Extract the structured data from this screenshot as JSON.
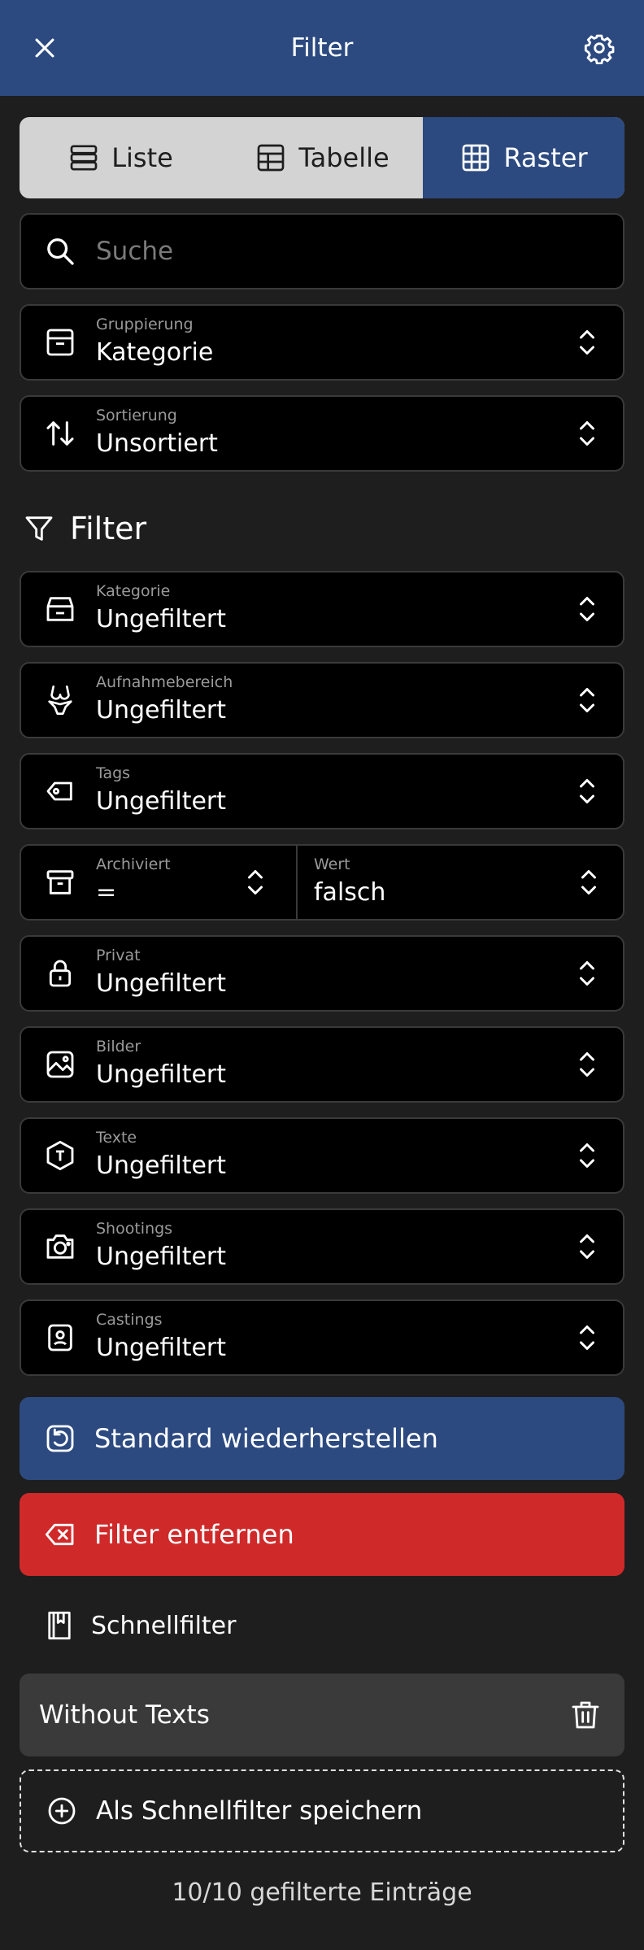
{
  "header": {
    "title": "Filter",
    "close_icon": "close-icon",
    "settings_icon": "gear-icon"
  },
  "view_toggle": {
    "items": [
      {
        "label": "Liste",
        "icon": "list-icon",
        "active": false
      },
      {
        "label": "Tabelle",
        "icon": "table-icon",
        "active": false
      },
      {
        "label": "Raster",
        "icon": "grid-icon",
        "active": true
      }
    ]
  },
  "search": {
    "placeholder": "Suche",
    "value": ""
  },
  "grouping": {
    "label": "Gruppierung",
    "value": "Kategorie"
  },
  "sorting": {
    "label": "Sortierung",
    "value": "Unsortiert"
  },
  "filter_section": {
    "title": "Filter",
    "fields": [
      {
        "label": "Kategorie",
        "value": "Ungefiltert"
      },
      {
        "label": "Aufnahmebereich",
        "value": "Ungefiltert"
      },
      {
        "label": "Tags",
        "value": "Ungefiltert"
      },
      {
        "label": "Archiviert",
        "value": "=",
        "value_label": "Wert",
        "value_value": "falsch"
      },
      {
        "label": "Privat",
        "value": "Ungefiltert"
      },
      {
        "label": "Bilder",
        "value": "Ungefiltert"
      },
      {
        "label": "Texte",
        "value": "Ungefiltert"
      },
      {
        "label": "Shootings",
        "value": "Ungefiltert"
      },
      {
        "label": "Castings",
        "value": "Ungefiltert"
      }
    ]
  },
  "actions": {
    "restore_label": "Standard wiederherstellen",
    "remove_label": "Filter entfernen"
  },
  "quick_filters": {
    "title": "Schnellfilter",
    "items": [
      {
        "label": "Without Texts"
      }
    ],
    "save_label": "Als Schnellfilter speichern"
  },
  "footer": {
    "status": "10/10 gefilterte Einträge"
  },
  "colors": {
    "header": "#2c4a80",
    "accent_blue": "#2c4a80",
    "danger_red": "#d0292a",
    "background": "#1e1e1e"
  }
}
